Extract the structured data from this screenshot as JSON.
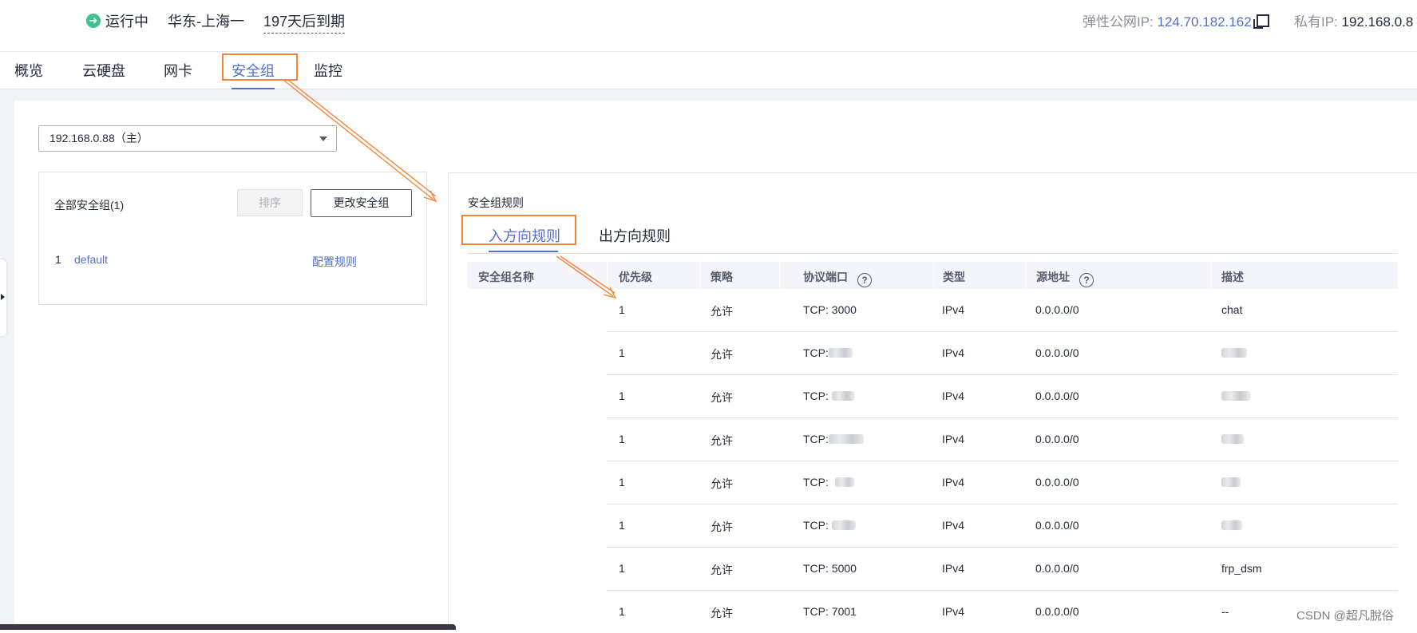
{
  "header": {
    "status": "运行中",
    "region": "华东-上海一",
    "expire": "197天后到期",
    "eip_label": "弹性公网IP: ",
    "eip_value": "124.70.182.162",
    "private_ip_label": "私有IP: ",
    "private_ip_value": "192.168.0.8"
  },
  "tabs": [
    "概览",
    "云硬盘",
    "网卡",
    "安全组",
    "监控"
  ],
  "active_tab": "安全组",
  "nic_select": "192.168.0.88（主）",
  "sg_list": {
    "title": "全部安全组(1)",
    "sort_button": "排序",
    "change_button": "更改安全组",
    "items": [
      {
        "no": "1",
        "name": "default",
        "action": "配置规则"
      }
    ]
  },
  "rules": {
    "title": "安全组规则",
    "tab_in": "入方向规则",
    "tab_out": "出方向规则",
    "columns": [
      "安全组名称",
      "优先级",
      "策略",
      "协议端口",
      "类型",
      "源地址",
      "描述"
    ],
    "rows": [
      {
        "priority": "1",
        "action": "允许",
        "port": "TCP: 3000",
        "type": "IPv4",
        "source": "0.0.0.0/0",
        "desc": "chat"
      },
      {
        "priority": "1",
        "action": "允许",
        "port": "TCP:",
        "type": "IPv4",
        "source": "0.0.0.0/0",
        "desc": ""
      },
      {
        "priority": "1",
        "action": "允许",
        "port": "TCP:",
        "type": "IPv4",
        "source": "0.0.0.0/0",
        "desc": ""
      },
      {
        "priority": "1",
        "action": "允许",
        "port": "TCP:",
        "type": "IPv4",
        "source": "0.0.0.0/0",
        "desc": ""
      },
      {
        "priority": "1",
        "action": "允许",
        "port": "TCP:",
        "type": "IPv4",
        "source": "0.0.0.0/0",
        "desc": ""
      },
      {
        "priority": "1",
        "action": "允许",
        "port": "TCP:",
        "type": "IPv4",
        "source": "0.0.0.0/0",
        "desc": ""
      },
      {
        "priority": "1",
        "action": "允许",
        "port": "TCP: 5000",
        "type": "IPv4",
        "source": "0.0.0.0/0",
        "desc": "frp_dsm"
      },
      {
        "priority": "1",
        "action": "允许",
        "port": "TCP: 7001",
        "type": "IPv4",
        "source": "0.0.0.0/0",
        "desc": "--"
      }
    ]
  },
  "watermark": "CSDN @超凡脫俗",
  "colors": {
    "accent": "#526ecc",
    "highlight": "#f5843a",
    "running": "#3ec28f"
  }
}
